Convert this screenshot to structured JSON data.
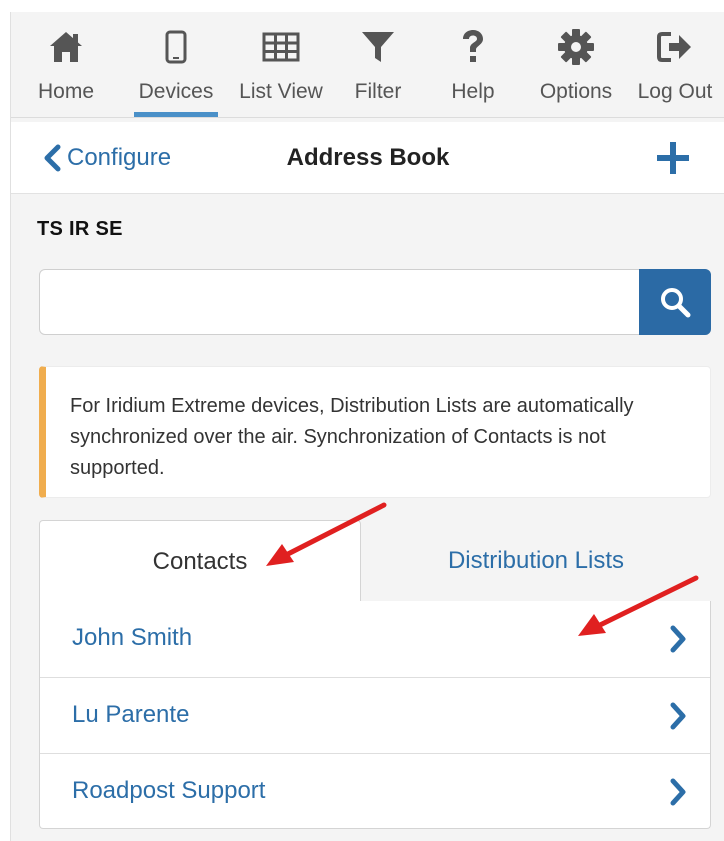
{
  "toolbar": {
    "items": [
      {
        "label": "Home",
        "icon": "home-icon"
      },
      {
        "label": "Devices",
        "icon": "mobile-device-icon",
        "active": true
      },
      {
        "label": "List View",
        "icon": "grid-table-icon"
      },
      {
        "label": "Filter",
        "icon": "filter-funnel-icon"
      },
      {
        "label": "Help",
        "icon": "question-mark-icon"
      },
      {
        "label": "Options",
        "icon": "gear-icon"
      },
      {
        "label": "Log Out",
        "icon": "sign-out-icon"
      }
    ]
  },
  "header": {
    "back_label": "Configure",
    "title": "Address Book",
    "add_icon": "plus-icon"
  },
  "device_name": "TS IR SE",
  "search": {
    "value": "",
    "placeholder": "",
    "button_icon": "search-icon"
  },
  "notice": {
    "text": "For Iridium Extreme devices, Distribution Lists are automatically synchronized over the air. Synchronization of Contacts is not supported."
  },
  "tabs": [
    {
      "label": "Contacts",
      "active": true
    },
    {
      "label": "Distribution Lists",
      "active": false
    }
  ],
  "contacts": [
    {
      "name": "John Smith"
    },
    {
      "name": "Lu Parente"
    },
    {
      "name": "Roadpost Support"
    }
  ],
  "colors": {
    "toolbar_icon": "#555555",
    "link_blue": "#2c6ea8",
    "search_button": "#2b6aa5",
    "active_underline": "#4a90c8",
    "notice_accent": "#f0ad4e",
    "annotation_arrow": "#e02020"
  }
}
